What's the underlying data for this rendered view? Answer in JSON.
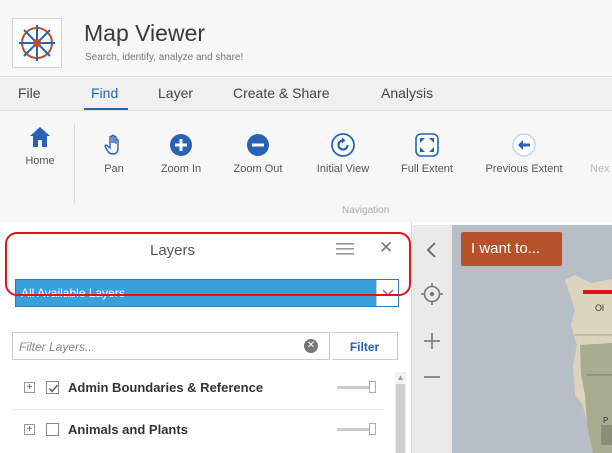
{
  "app": {
    "title": "Map Viewer",
    "subtitle": "Search, identify, analyze and share!"
  },
  "tabs": [
    {
      "label": "File"
    },
    {
      "label": "Find"
    },
    {
      "label": "Layer"
    },
    {
      "label": "Create & Share"
    },
    {
      "label": "Analysis"
    }
  ],
  "toolbar": {
    "home": "Home",
    "pan": "Pan",
    "zoom_in": "Zoom In",
    "zoom_out": "Zoom Out",
    "initial_view": "Initial View",
    "full_extent": "Full Extent",
    "previous_extent": "Previous Extent",
    "next_extent_partial": "Nex",
    "group_label": "Navigation"
  },
  "map": {
    "i_want_to": "I want to...",
    "place_label": "Ol",
    "place_label_2": "P"
  },
  "layers_panel": {
    "title": "Layers",
    "select_value": "All Available Layers",
    "filter_placeholder": "Filter Layers...",
    "filter_button": "Filter",
    "items": [
      {
        "label": "Admin Boundaries & Reference",
        "checked": true
      },
      {
        "label": "Animals and Plants",
        "checked": false
      }
    ]
  },
  "colors": {
    "accent": "#2a62b3",
    "select_bg": "#3aa0dc",
    "i_want_bg": "#b5522c",
    "highlight": "#e1131a"
  },
  "icons": {
    "home": "home-icon",
    "pan": "hand-icon",
    "zoom_in": "plus-circle-icon",
    "zoom_out": "minus-circle-icon",
    "initial_view": "refresh-icon",
    "full_extent": "expand-icon",
    "previous_extent": "back-arrow-icon"
  }
}
